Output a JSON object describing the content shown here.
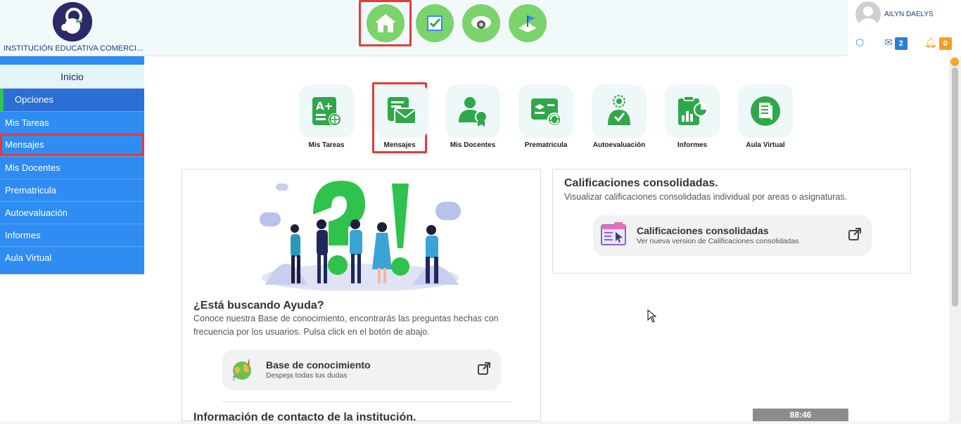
{
  "header": {
    "institution": "INSTITUCIÓN EDUCATIVA COMERCI...",
    "nav": [
      {
        "name": "home-icon",
        "active": true
      },
      {
        "name": "checklist-icon",
        "active": false
      },
      {
        "name": "camera-icon",
        "active": false
      },
      {
        "name": "graduation-cap-icon",
        "active": false
      }
    ],
    "user": {
      "name": "AILYN DAELYS",
      "messages": "2",
      "notifications": "0"
    },
    "colors": {
      "accent": "#2f8cf3",
      "green": "#2fa84a",
      "badge_blue": "#2b7fd0",
      "badge_orange": "#f0a020"
    }
  },
  "sidebar": {
    "home": "Inicio",
    "options": "Opciones",
    "items": [
      "Mis Tareas",
      "Mensajes",
      "Mis Docentes",
      "Prematricula",
      "Autoevaluación",
      "Informes",
      "Aula Virtual"
    ]
  },
  "modules": [
    "Mis Tareas",
    "Mensajes",
    "Mis Docentes",
    "Prematricula",
    "Autoevaluación",
    "Informes",
    "Aula Virtual"
  ],
  "help": {
    "title": "¿Está buscando Ayuda?",
    "text": "Conoce nuestra Base de conocimiento, encontrarás las preguntas hechas con frecuencia por los usuarios. Pulsa click en el botón de abajo.",
    "button_title": "Base de conocimiento",
    "button_sub": "Despeja todas tus dudas",
    "contact_title": "Información de contacto de la institución."
  },
  "grades": {
    "title": "Calificaciones consolidadas.",
    "text": "Visualizar calificaciones consolidadas individual por areas o asignaturas.",
    "button_title": "Calificaciones consolidadas",
    "button_sub": "Ver nueva version de Calificaciones consolidadas"
  },
  "timer": "88:46"
}
